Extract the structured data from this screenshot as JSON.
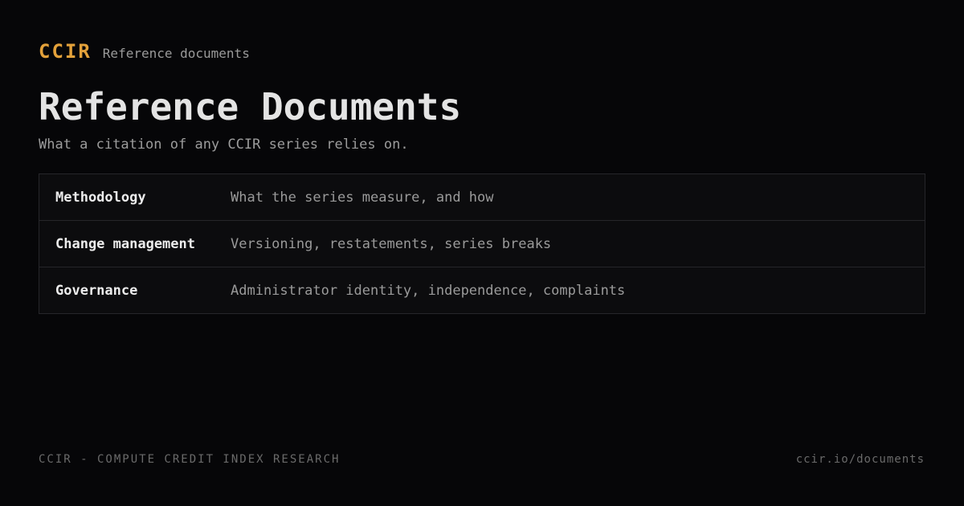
{
  "header": {
    "brand": "CCIR",
    "section": "Reference documents"
  },
  "main": {
    "title": "Reference Documents",
    "subtitle": "What a citation of any CCIR series relies on.",
    "documents": [
      {
        "name": "Methodology",
        "description": "What the series measure, and how"
      },
      {
        "name": "Change management",
        "description": "Versioning, restatements, series breaks"
      },
      {
        "name": "Governance",
        "description": "Administrator identity, independence, complaints"
      }
    ]
  },
  "footer": {
    "org": "CCIR - COMPUTE CREDIT INDEX RESEARCH",
    "url": "ccir.io/documents"
  },
  "colors": {
    "background": "#060608",
    "accent": "#e3a13a"
  }
}
